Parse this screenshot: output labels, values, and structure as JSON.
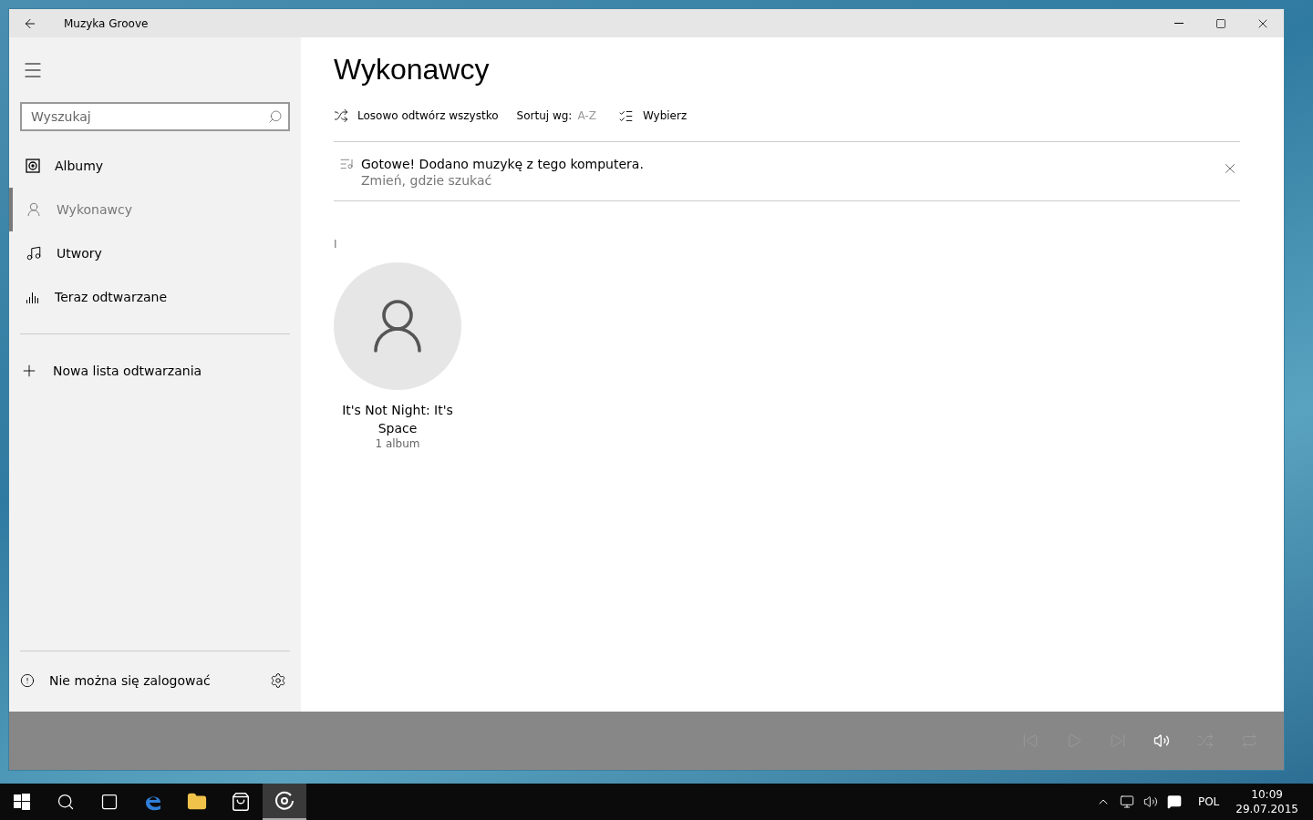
{
  "window": {
    "title": "Muzyka Groove"
  },
  "sidebar": {
    "search": {
      "placeholder": "Wyszukaj"
    },
    "items": [
      {
        "kind": "album",
        "label": "Albumy",
        "selected": false
      },
      {
        "kind": "artist",
        "label": "Wykonawcy",
        "selected": true
      },
      {
        "kind": "song",
        "label": "Utwory",
        "selected": false
      },
      {
        "kind": "nowplaying",
        "label": "Teraz odtwarzane",
        "selected": false
      }
    ],
    "new_playlist": "Nowa lista odtwarzania",
    "sign_in_status": "Nie można się zalogować"
  },
  "page": {
    "title": "Wykonawcy",
    "toolbar": {
      "shuffle": "Losowo odtwórz wszystko",
      "sort_label": "Sortuj wg:",
      "sort_value": "A-Z",
      "select": "Wybierz"
    },
    "notice": {
      "message": "Gotowe! Dodano muzykę z tego komputera.",
      "link": "Zmień, gdzie szukać"
    },
    "group_letter": "I",
    "artists": [
      {
        "name": "It's Not Night: It's Space",
        "count": "1 album"
      }
    ]
  },
  "player": {
    "controls": [
      {
        "kind": "previous",
        "disabled": true
      },
      {
        "kind": "play",
        "disabled": true
      },
      {
        "kind": "next",
        "disabled": true
      },
      {
        "kind": "volume",
        "disabled": false
      },
      {
        "kind": "shuffle",
        "disabled": true
      },
      {
        "kind": "repeat",
        "disabled": true
      }
    ]
  },
  "taskbar": {
    "apps": [
      {
        "kind": "start",
        "selected": false
      },
      {
        "kind": "search",
        "selected": false
      },
      {
        "kind": "taskview",
        "selected": false
      },
      {
        "kind": "browser",
        "selected": false
      },
      {
        "kind": "files",
        "selected": false
      },
      {
        "kind": "store",
        "selected": false
      },
      {
        "kind": "groove",
        "selected": true
      }
    ],
    "language": "POL",
    "time": "10:09",
    "date": "29.07.2015"
  }
}
